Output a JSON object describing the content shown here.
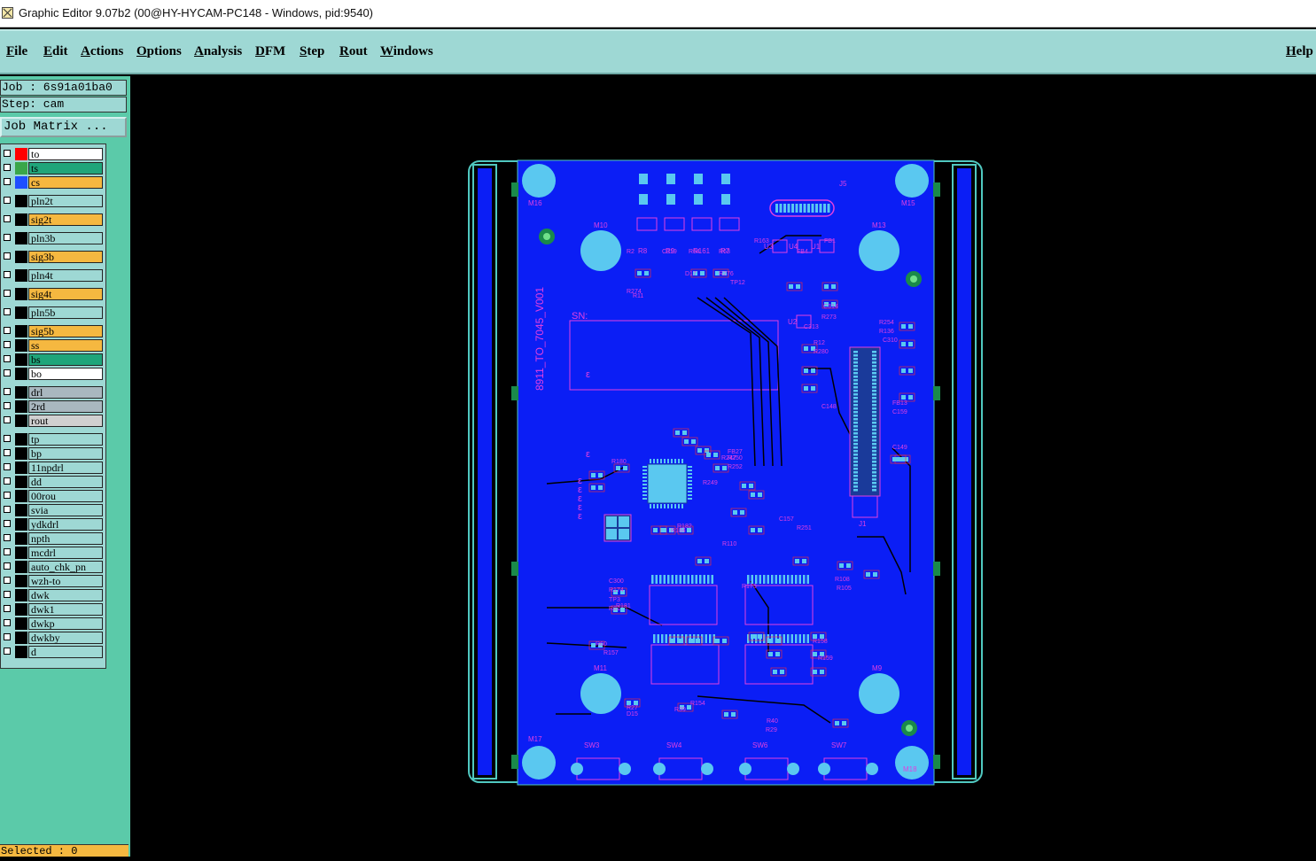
{
  "window": {
    "title": "Graphic Editor 9.07b2 (00@HY-HYCAM-PC148 - Windows, pid:9540)"
  },
  "menubar": {
    "items": [
      "File",
      "Edit",
      "Actions",
      "Options",
      "Analysis",
      "DFM",
      "Step",
      "Rout",
      "Windows"
    ],
    "help": "Help"
  },
  "panel": {
    "job": "Job : 6s91a01ba0",
    "step": "Step: cam",
    "job_matrix": "Job Matrix ..."
  },
  "layers": [
    {
      "name": "to",
      "color": "#ffffff",
      "swatch": "#ff0000"
    },
    {
      "name": "ts",
      "color": "#1fa57a",
      "swatch": "#3aa64a"
    },
    {
      "name": "cs",
      "color": "#f5b840",
      "swatch": "#1e4fff"
    },
    {
      "name": "pln2t",
      "color": "#9ed8d4"
    },
    {
      "name": "sig2t",
      "color": "#f5b840"
    },
    {
      "name": "pln3b",
      "color": "#9ed8d4"
    },
    {
      "name": "sig3b",
      "color": "#f5b840"
    },
    {
      "name": "pln4t",
      "color": "#9ed8d4"
    },
    {
      "name": "sig4t",
      "color": "#f5b840"
    },
    {
      "name": "pln5b",
      "color": "#9ed8d4"
    },
    {
      "name": "sig5b",
      "color": "#f5b840"
    },
    {
      "name": "ss",
      "color": "#f5b840"
    },
    {
      "name": "bs",
      "color": "#1fa57a"
    },
    {
      "name": "bo",
      "color": "#ffffff"
    },
    {
      "name": "drl",
      "color": "#a9b7bf"
    },
    {
      "name": "2rd",
      "color": "#a9b7bf"
    },
    {
      "name": "rout",
      "color": "#d0d0d0"
    },
    {
      "name": "tp",
      "color": "#9ed8d4"
    },
    {
      "name": "bp",
      "color": "#9ed8d4"
    },
    {
      "name": "11npdrl",
      "color": "#9ed8d4"
    },
    {
      "name": "dd",
      "color": "#9ed8d4"
    },
    {
      "name": "00rou",
      "color": "#9ed8d4"
    },
    {
      "name": "svia",
      "color": "#9ed8d4"
    },
    {
      "name": "ydkdrl",
      "color": "#9ed8d4"
    },
    {
      "name": "npth",
      "color": "#9ed8d4"
    },
    {
      "name": "mcdrl",
      "color": "#9ed8d4"
    },
    {
      "name": "auto_chk_pn",
      "color": "#9ed8d4"
    },
    {
      "name": "wzh-to",
      "color": "#9ed8d4"
    },
    {
      "name": "dwk",
      "color": "#9ed8d4"
    },
    {
      "name": "dwk1",
      "color": "#9ed8d4"
    },
    {
      "name": "dwkp",
      "color": "#9ed8d4"
    },
    {
      "name": "dwkby",
      "color": "#9ed8d4"
    },
    {
      "name": "d",
      "color": "#9ed8d4"
    }
  ],
  "status": {
    "selected": "Selected : 0"
  },
  "board": {
    "silkscreen_text": "8911_TO_7045_V001",
    "sn_label": "SN:",
    "mount_labels": [
      "M16",
      "M15",
      "M10",
      "M13",
      "M11",
      "M9",
      "M17",
      "M18"
    ],
    "switch_labels": [
      "SW3",
      "SW4",
      "SW6",
      "SW7"
    ],
    "connector_labels": [
      "J5",
      "J1"
    ],
    "component_labels": [
      "R8",
      "R9",
      "R161",
      "R7",
      "U3",
      "U4",
      "U1",
      "U2",
      "R3",
      "R1",
      "R2",
      "C319",
      "R64",
      "R63",
      "R163",
      "FB4",
      "FB1",
      "C313",
      "C314",
      "R273",
      "R274",
      "R276",
      "TP12",
      "D17",
      "R11",
      "R12",
      "R280",
      "R254",
      "R136",
      "C310",
      "C148",
      "C149",
      "FB13",
      "C159",
      "C157",
      "R251",
      "R249",
      "R250",
      "R252",
      "R247",
      "R180",
      "R181",
      "R184",
      "R182",
      "FB27",
      "C300",
      "R174",
      "TP3",
      "R61",
      "R60",
      "R157",
      "R158",
      "R159",
      "R154",
      "R39",
      "R40",
      "R29",
      "R27",
      "D15",
      "R108",
      "R105",
      "R110",
      "R173",
      "C301",
      "C302",
      "R175",
      "C303",
      "R62",
      "R14"
    ]
  },
  "colors": {
    "board": "#0b1ef5",
    "silk": "#e040e0",
    "pad": "#5ac8f0",
    "frame": "#50c8c0"
  }
}
